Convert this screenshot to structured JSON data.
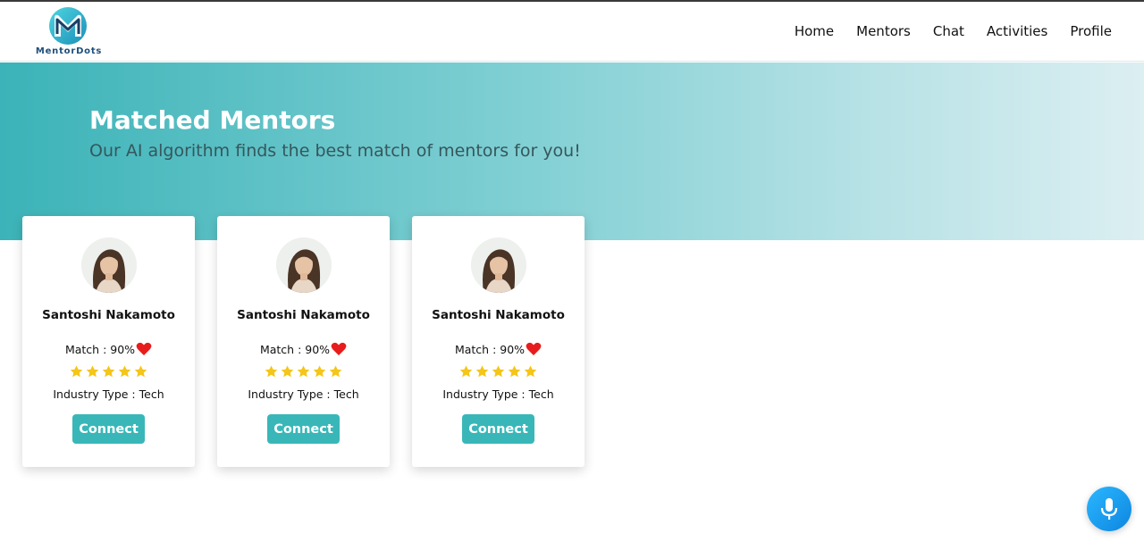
{
  "brand": {
    "name": "MentorDots",
    "color": "#1d4f7a"
  },
  "nav": {
    "items": [
      "Home",
      "Mentors",
      "Chat",
      "Activities",
      "Profile"
    ]
  },
  "hero": {
    "title": "Matched Mentors",
    "subtitle": "Our AI algorithm finds the best match of mentors for you!"
  },
  "cards": [
    {
      "name": "Santoshi Nakamoto",
      "match": "Match : 90%",
      "industry": "Industry Type : Tech",
      "rating": 5,
      "connect_label": "Connect",
      "avatar_icon": "mentor-avatar"
    },
    {
      "name": "Santoshi Nakamoto",
      "match": "Match : 90%",
      "industry": "Industry Type : Tech",
      "rating": 5,
      "connect_label": "Connect",
      "avatar_icon": "mentor-avatar"
    },
    {
      "name": "Santoshi Nakamoto",
      "match": "Match : 90%",
      "industry": "Industry Type : Tech",
      "rating": 5,
      "connect_label": "Connect",
      "avatar_icon": "mentor-avatar"
    }
  ],
  "colors": {
    "accent": "#39b7b8",
    "heart": "#e81c1c",
    "star": "#f5c518",
    "mic": "#1a9cf0"
  },
  "icons": {
    "heart": "heart-icon",
    "star": "star-icon",
    "mic": "microphone-icon"
  }
}
